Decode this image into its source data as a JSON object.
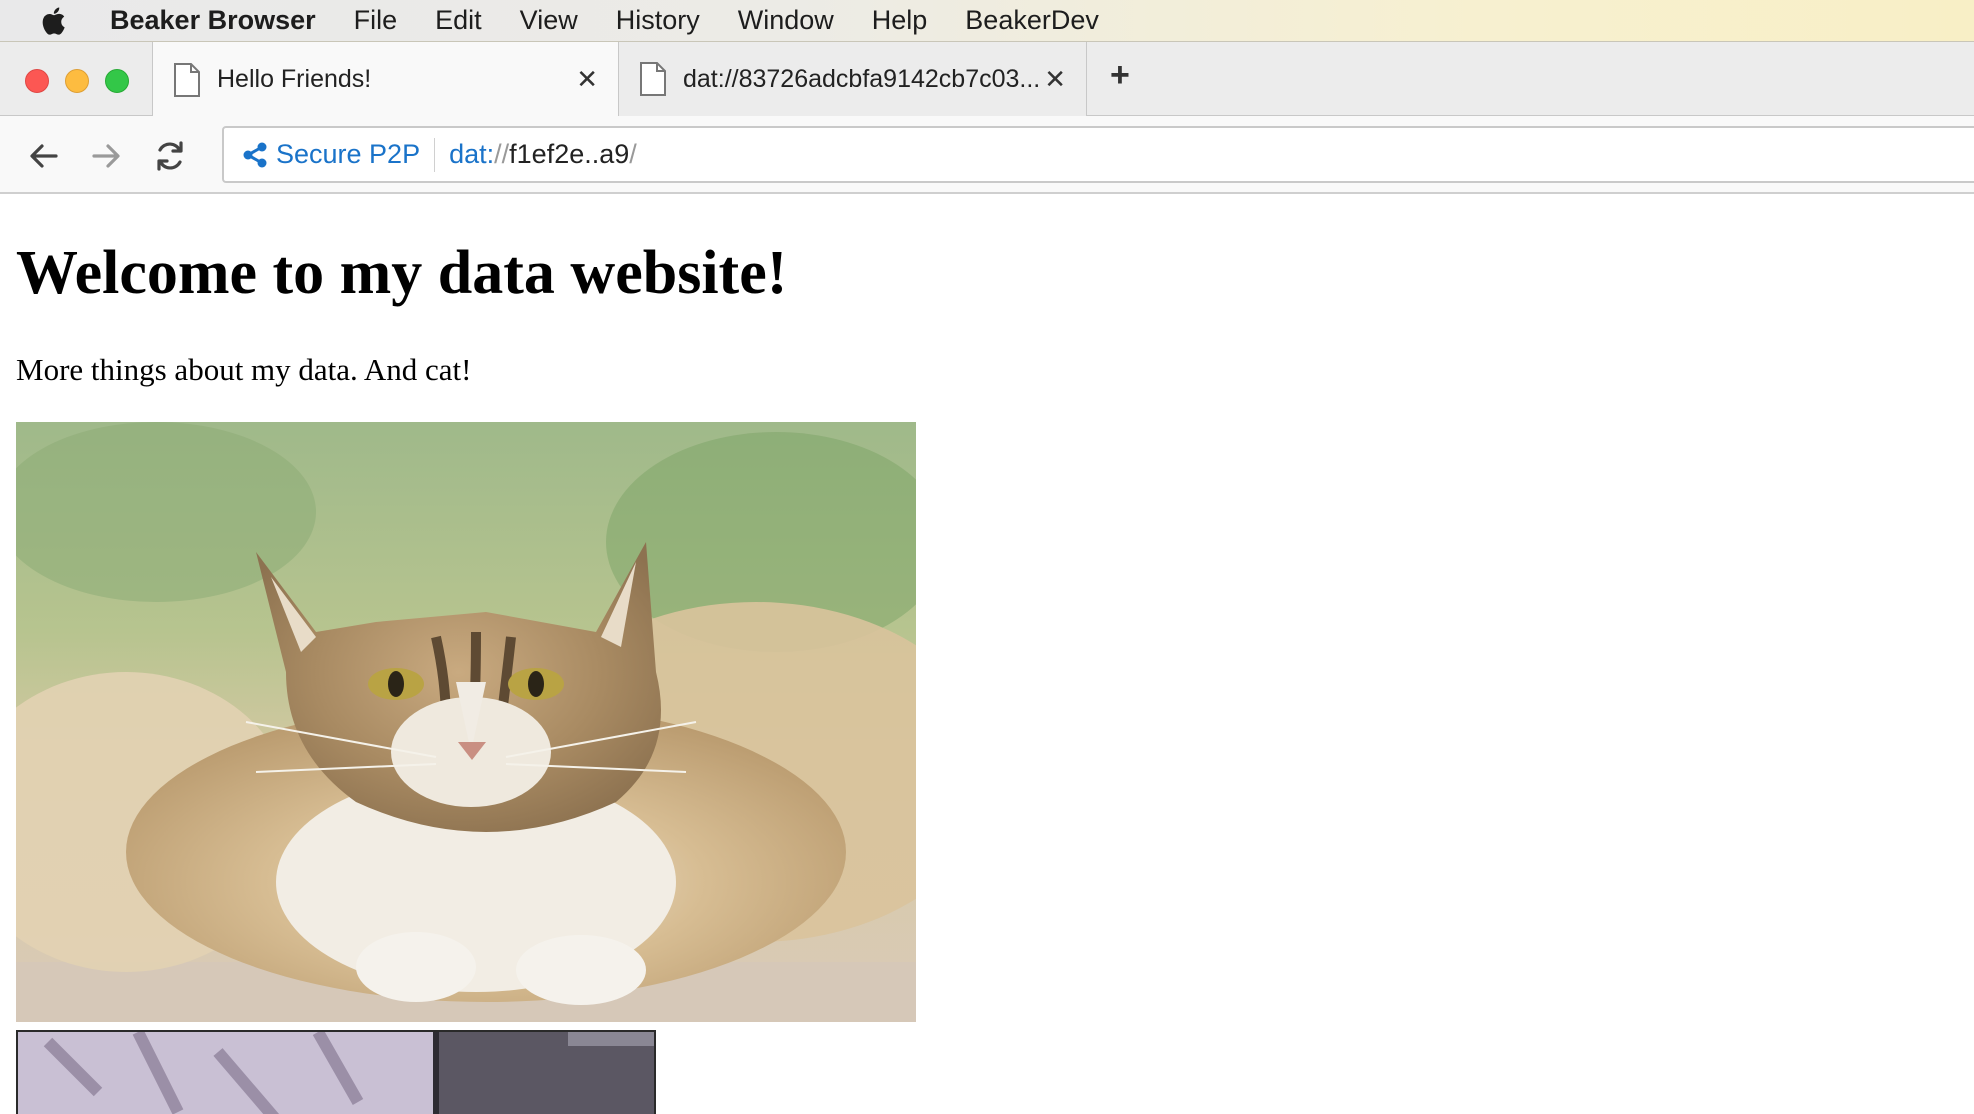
{
  "menubar": {
    "app_name": "Beaker Browser",
    "items": [
      "File",
      "Edit",
      "View",
      "History",
      "Window",
      "Help",
      "BeakerDev"
    ]
  },
  "tabs": [
    {
      "title": "Hello Friends!",
      "active": true
    },
    {
      "title": "dat://83726adcbfa9142cb7c03...",
      "active": false
    }
  ],
  "toolbar": {
    "secure_label": "Secure P2P",
    "url_scheme": "dat:",
    "url_slashes": "//",
    "url_host": "f1ef2e..a9",
    "url_trailing": "/"
  },
  "page": {
    "heading": "Welcome to my data website!",
    "paragraph": "More things about my data. And cat!"
  },
  "colors": {
    "link_blue": "#1a73c9",
    "close_red": "#fc5753",
    "minimize_yellow": "#fdbc40",
    "zoom_green": "#33c748"
  },
  "icons": [
    "apple-icon",
    "page-icon",
    "close-icon",
    "plus-icon",
    "back-arrow-icon",
    "forward-arrow-icon",
    "reload-icon",
    "share-icon"
  ]
}
